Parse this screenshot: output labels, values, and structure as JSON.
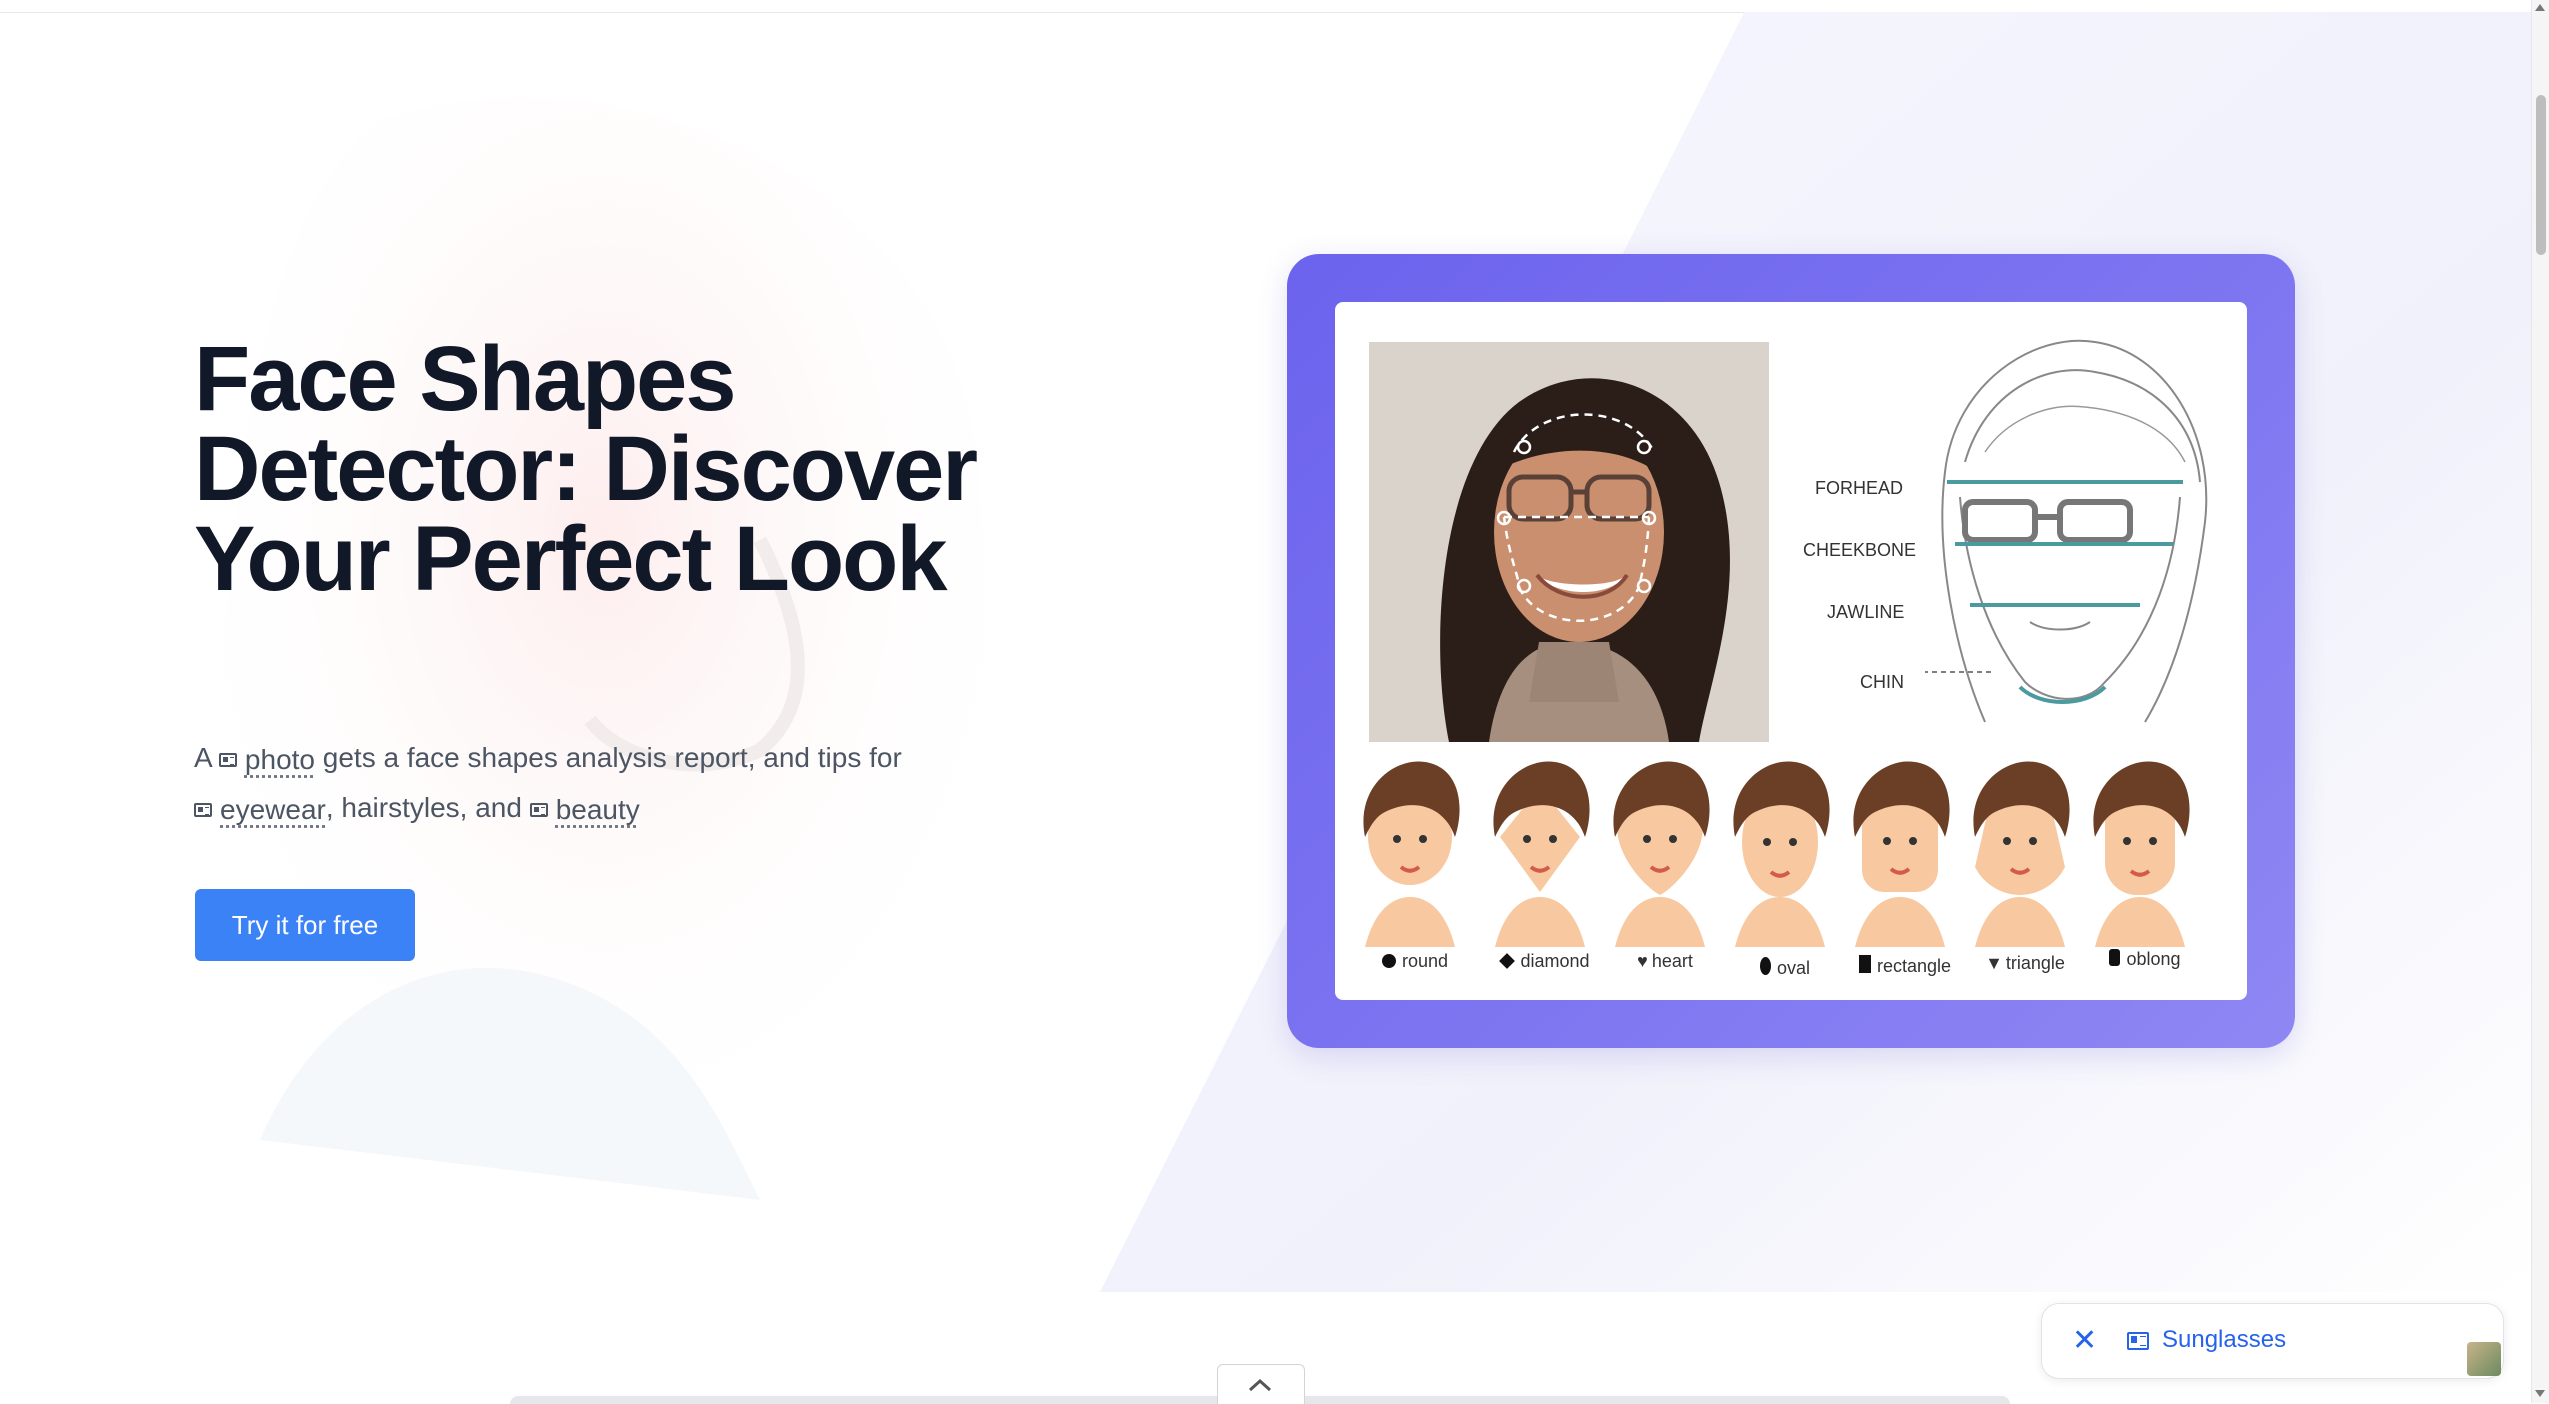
{
  "hero": {
    "title": "Face Shapes Detector: Discover Your Perfect Look",
    "desc": {
      "a": "A ",
      "photo": "photo",
      "mid": " gets a face shapes analysis report, and tips for ",
      "eyewear": "eyewear",
      "mid2": ", hairstyles, and ",
      "beauty": "beauty"
    },
    "cta_label": "Try it for free"
  },
  "illustration": {
    "measures": [
      "FORHEAD",
      "CHEEKBONE",
      "JAWLINE",
      "CHIN"
    ],
    "shapes": [
      "round",
      "diamond",
      "heart",
      "oval",
      "rectangle",
      "triangle",
      "oblong"
    ],
    "colors": {
      "frame": "#6c63ee",
      "teal": "#4a9aa0",
      "skin": "#f8c9a0",
      "hair": "#6b3e26"
    }
  },
  "chip": {
    "label": "Sunglasses",
    "close_icon": "close-icon",
    "icon": "wikipedia-icon"
  },
  "colors": {
    "accent": "#3b82f6",
    "title": "#111827",
    "text": "#4b5563",
    "link": "#2563eb"
  }
}
